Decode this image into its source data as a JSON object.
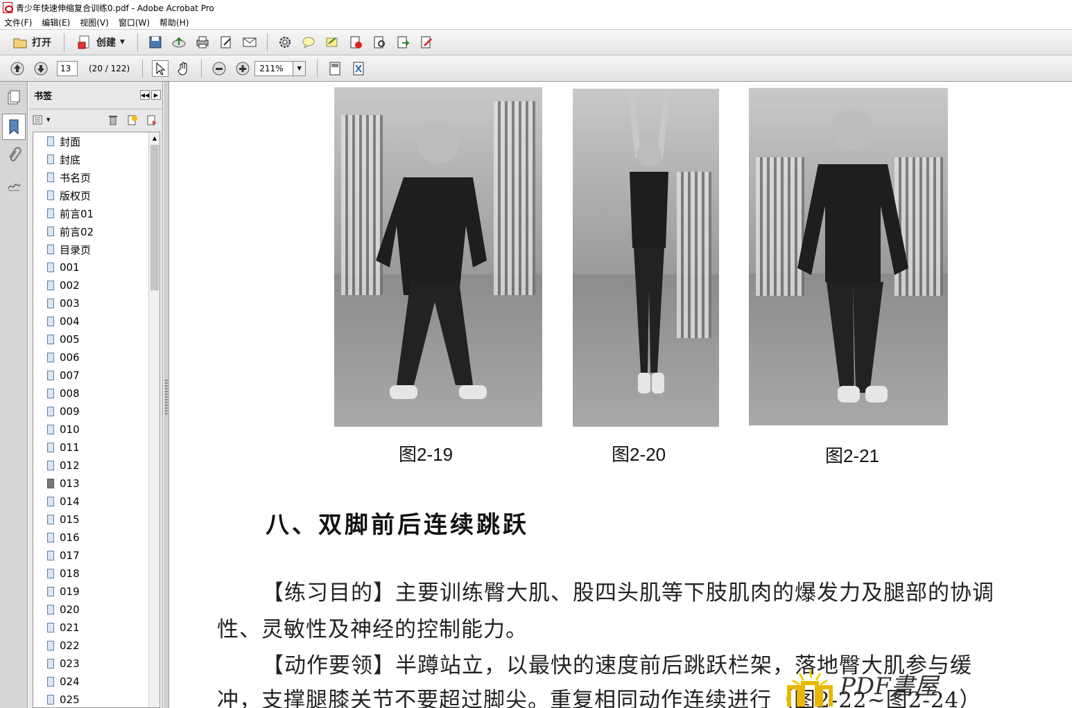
{
  "window": {
    "title": "青少年快速伸缩复合训练0.pdf - Adobe Acrobat Pro"
  },
  "menu": [
    "文件(F)",
    "编辑(E)",
    "视图(V)",
    "窗口(W)",
    "帮助(H)"
  ],
  "toolbar": {
    "open_label": "打开",
    "create_label": "创建"
  },
  "nav": {
    "page_value": "13",
    "page_count": "(20 / 122)",
    "zoom_value": "211%"
  },
  "bookmarks": {
    "title": "书签",
    "items": [
      "封面",
      "封底",
      "书名页",
      "版权页",
      "前言01",
      "前言02",
      "目录页",
      "001",
      "002",
      "003",
      "004",
      "005",
      "006",
      "007",
      "008",
      "009",
      "010",
      "011",
      "012",
      "013",
      "014",
      "015",
      "016",
      "017",
      "018",
      "019",
      "020",
      "021",
      "022",
      "023",
      "024",
      "025"
    ],
    "current": "013"
  },
  "document": {
    "captions": [
      "图2-19",
      "图2-20",
      "图2-21"
    ],
    "section_title": "八、双脚前后连续跳跃",
    "para1_line1": "【练习目的】主要训练臀大肌、股四头肌等下肢肌肉的爆发力及腿部的协调",
    "para1_line2": "性、灵敏性及神经的控制能力。",
    "para2_line1": "【动作要领】半蹲站立，以最快的速度前后跳跃栏架，落地臀大肌参与缓",
    "para2_line2": "冲，支撑腿膝关节不要超过脚尖。重复相同动作连续进行（图2-22~图2-24）",
    "watermark": "PDF書屋"
  },
  "colors": {
    "toolbar_bg": "#e8e8e8",
    "panel_bg": "#e8e8e8",
    "bookmark_flag": "#5a7fa8"
  }
}
